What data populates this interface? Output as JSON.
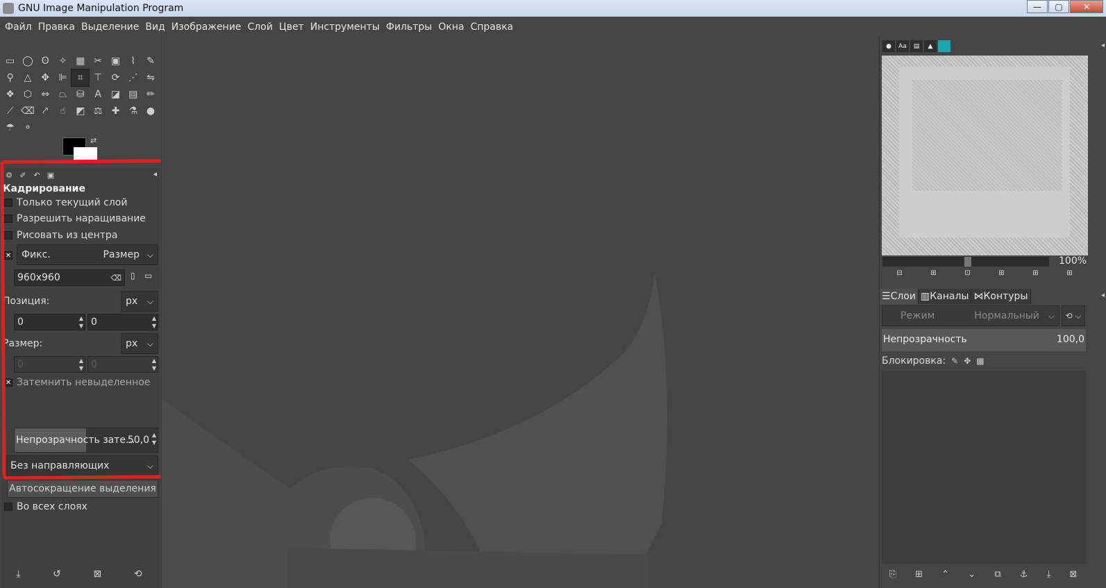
{
  "window": {
    "title": "GNU Image Manipulation Program",
    "minimize": "—",
    "maximize": "▢",
    "close": "✕"
  },
  "menu": [
    "Файл",
    "Правка",
    "Выделение",
    "Вид",
    "Изображение",
    "Слой",
    "Цвет",
    "Инструменты",
    "Фильтры",
    "Окна",
    "Справка"
  ],
  "tool_options": {
    "title": "Кадрирование",
    "current_layer_only": "Только текущий слой",
    "allow_growing": "Разрешить наращивание",
    "expand_from_center": "Рисовать из центра",
    "fixed_label": "Фикс.",
    "fixed_value": "Размер",
    "size_value": "960x960",
    "position_label": "Позиция:",
    "position_unit": "px",
    "position_x": "0",
    "position_y": "0",
    "size_label": "Размер:",
    "size_unit": "px",
    "size_w": "0",
    "size_h": "0",
    "highlight": "Затемнить невыделенное",
    "highlight_opacity_label": "Непрозрачность зате...",
    "highlight_opacity_value": "50,0",
    "guides": "Без направляющих",
    "auto_shrink": "Автосокращение выделения",
    "shrink_merged": "Во всех слоях"
  },
  "right_panel": {
    "zoom": "100%",
    "tabs": {
      "layers": "Слои",
      "channels": "Каналы",
      "paths": "Контуры"
    },
    "mode_label": "Режим",
    "mode_value": "Нормальный",
    "opacity_label": "Непрозрачность",
    "opacity_value": "100,0",
    "lock_label": "Блокировка:"
  },
  "colors": {
    "highlight_frame": "#e02020",
    "fg": "#000000",
    "bg": "#ffffff"
  }
}
